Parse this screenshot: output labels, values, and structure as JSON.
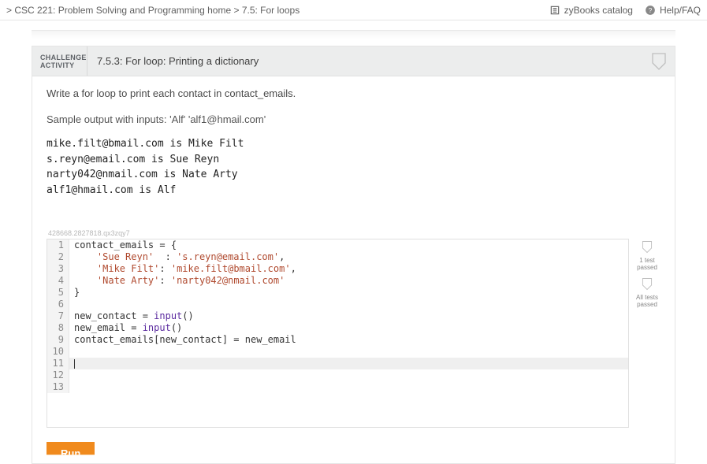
{
  "top": {
    "breadcrumb": "> CSC 221: Problem Solving and Programming home > 7.5: For loops",
    "catalog": "zyBooks catalog",
    "help": "Help/FAQ"
  },
  "head": {
    "kicker1": "CHALLENGE",
    "kicker2": "ACTIVITY",
    "title": "7.5.3: For loop: Printing a dictionary"
  },
  "body": {
    "prompt": "Write a for loop to print each contact in contact_emails.",
    "sample_label": "Sample output with inputs: 'Alf' 'alf1@hmail.com'",
    "sample_output": "mike.filt@bmail.com is Mike Filt\ns.reyn@email.com is Sue Reyn\nnarty042@nmail.com is Nate Arty\nalf1@hmail.com is Alf",
    "question_id": "428668.2827818.qx3zqy7"
  },
  "editor": {
    "lines": [
      {
        "n": 1,
        "plain": "contact_emails = {"
      },
      {
        "n": 2,
        "indent": "    ",
        "str1": "'Sue Reyn'",
        "mid": "  : ",
        "str2": "'s.reyn@email.com'",
        "tail": ","
      },
      {
        "n": 3,
        "indent": "    ",
        "str1": "'Mike Filt'",
        "mid": ": ",
        "str2": "'mike.filt@bmail.com'",
        "tail": ","
      },
      {
        "n": 4,
        "indent": "    ",
        "str1": "'Nate Arty'",
        "mid": ": ",
        "str2": "'narty042@nmail.com'",
        "tail": ""
      },
      {
        "n": 5,
        "plain": "}"
      },
      {
        "n": 6,
        "plain": ""
      },
      {
        "n": 7,
        "pre": "new_contact = ",
        "fn": "input",
        "post": "()"
      },
      {
        "n": 8,
        "pre": "new_email = ",
        "fn": "input",
        "post": "()"
      },
      {
        "n": 9,
        "plain": "contact_emails[new_contact] = new_email"
      },
      {
        "n": 10,
        "plain": ""
      },
      {
        "n": 11,
        "plain": "",
        "cursor": true
      },
      {
        "n": 12,
        "plain": ""
      },
      {
        "n": 13,
        "plain": ""
      }
    ]
  },
  "side": {
    "t1": "1 test",
    "p1": "passed",
    "t2": "All tests",
    "p2": "passed"
  },
  "run": {
    "label": "Run"
  }
}
